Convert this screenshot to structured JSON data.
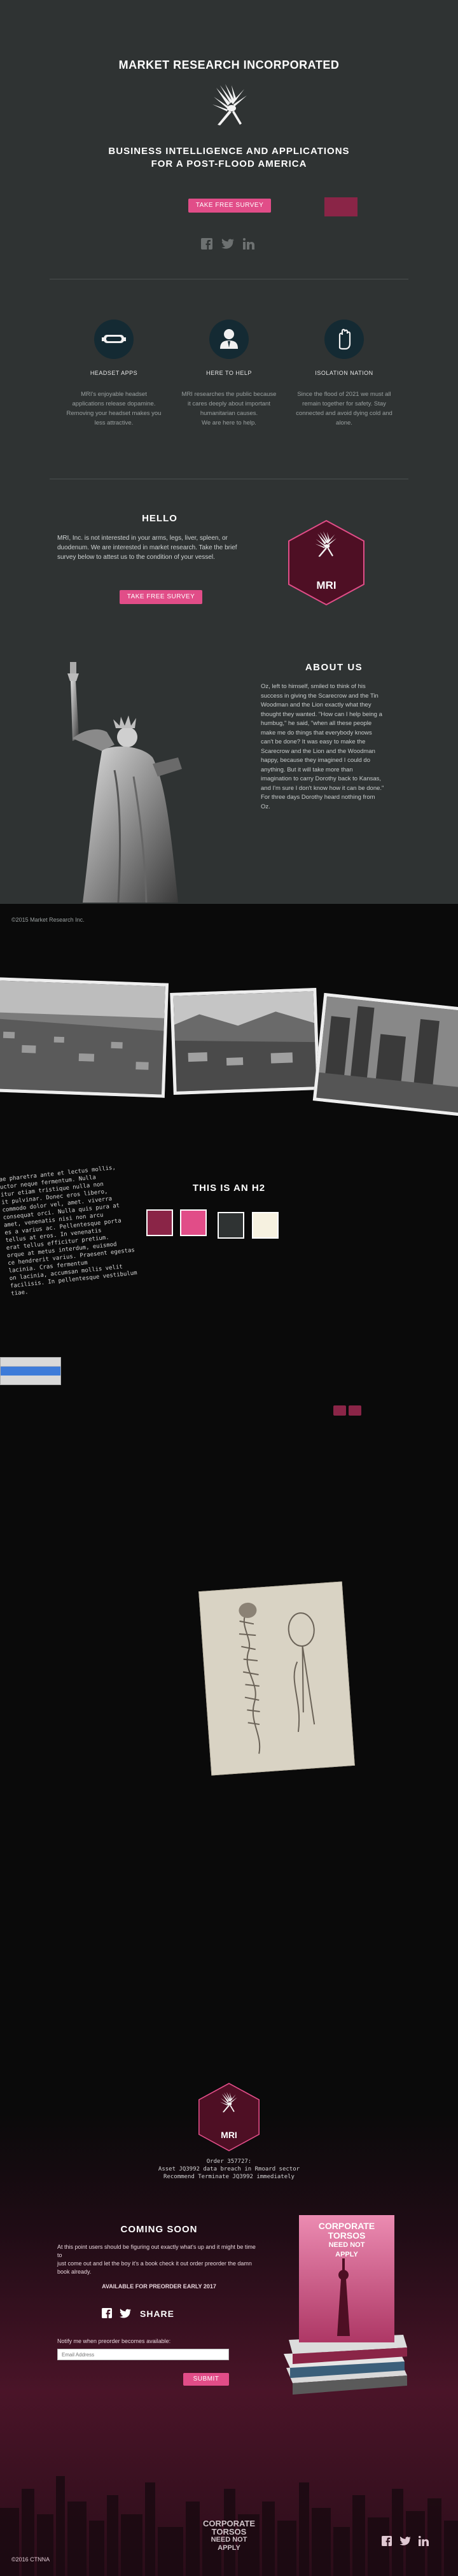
{
  "hero": {
    "title": "MARKET RESEARCH INCORPORATED",
    "tagline_line1": "BUSINESS INTELLIGENCE AND APPLICATIONS",
    "tagline_line2": "FOR A POST-FLOOD AMERICA",
    "cta_label": "TAKE FREE SURVEY",
    "social_icons": [
      "facebook-icon",
      "twitter-icon",
      "linkedin-icon"
    ]
  },
  "features": [
    {
      "icon": "headset-icon",
      "title": "HEADSET APPS",
      "text": [
        "MRI's enjoyable headset",
        "applications release dopamine.",
        "Removing your headset makes you",
        "less attractive."
      ]
    },
    {
      "icon": "person-icon",
      "title": "HERE TO HELP",
      "text": [
        "MRI researches the public because",
        "it cares deeply about important",
        "humanitarian causes.",
        "We are here to help."
      ]
    },
    {
      "icon": "hand-icon",
      "title": "ISOLATION NATION",
      "text": [
        "Since the flood of 2021 we must all",
        "remain together for safety.  Stay",
        "connected and avoid dying cold and",
        "alone."
      ]
    }
  ],
  "hello": {
    "title": "HELLO",
    "text": [
      "MRI, Inc. is not interested in your arms, legs, liver, spleen, or",
      "duodenum.  We are interested in market research. Take the brief",
      "survey below to attest us to the condition of your vessel."
    ],
    "cta_label": "TAKE FREE SURVEY",
    "badge_text": "MRI"
  },
  "about": {
    "title": "ABOUT US",
    "text": [
      "Oz, left to himself, smiled to think of his",
      "success in giving the Scarecrow and the Tin",
      "Woodman and the Lion exactly what they",
      "thought they wanted.  \"How can I help being a",
      "humbug,\" he said, \"when all these people",
      "make me do things that everybody knows",
      "can't be done?  It was easy to make the",
      "Scarecrow and the Lion and the Woodman",
      "happy, because they imagined I could do",
      "anything.  But it will take more than",
      "imagination to carry Dorothy back to Kansas,",
      "and I'm sure I don't know how it can be done.\"",
      "For three days Dorothy heard nothing from",
      "Oz."
    ],
    "copyright": "©2015 Market Research Inc."
  },
  "code_block": [
    "ae pharetra ante et lectus mollis,",
    "uctor neque fermentum. Nulla",
    "itur etiam tristique nulla non",
    "it pulvinar. Donec eros libero,",
    "commodo dolor vel, amet. viverra",
    "consequat orci. Nulla quis pura at",
    "amet, venenatis nisi non arcu",
    "es a varius ac. Pellentesque porta",
    "tellus at eros. In venenatis",
    "erat tellus efficitur pretium.",
    "orque at metus interdum, euismod",
    "ce hendrerit varius. Praesent egestas",
    "lacinia. Cras fermentum",
    "on lacinia, accumsan mollis velit",
    "facilisis. In pellentesque vestibulum",
    "tiae."
  ],
  "section_h2": "THIS IS AN H2",
  "swatches": [
    "#8a2547",
    "#e14d88",
    "#2f3333",
    "#f6f1e0"
  ],
  "order": {
    "label": "Order 357727:",
    "line1": "Asset JQ3992 data breach in Rmoard sector",
    "line2": "Recommend Terminate JQ3992 immediately"
  },
  "coming_soon": {
    "title": "COMING SOON",
    "text": [
      "At this point users should be figuring out exactly what's up and it might be time to",
      "just come out and let the boy it's a book check it out order preorder the damn",
      "book already."
    ],
    "preorder": "AVAILABLE FOR PREORDER EARLY 2017",
    "share_label": "SHARE",
    "notify_label": "Notify me when preorder becomes available:",
    "email_placeholder": "Email Address",
    "submit_label": "SUBMIT",
    "book_title": [
      "CORPORATE",
      "TORSOS",
      "NEED NOT",
      "APPLY"
    ]
  },
  "footer": {
    "copyright": "©2016 CTNNA",
    "logo_lines": [
      "CORPORATE",
      "TORSOS",
      "NEED NOT",
      "APPLY"
    ]
  },
  "colors": {
    "accent": "#e14d88",
    "maroon": "#8a2547",
    "hero_bg": "#2f3333",
    "feature_circle": "#142a33"
  }
}
